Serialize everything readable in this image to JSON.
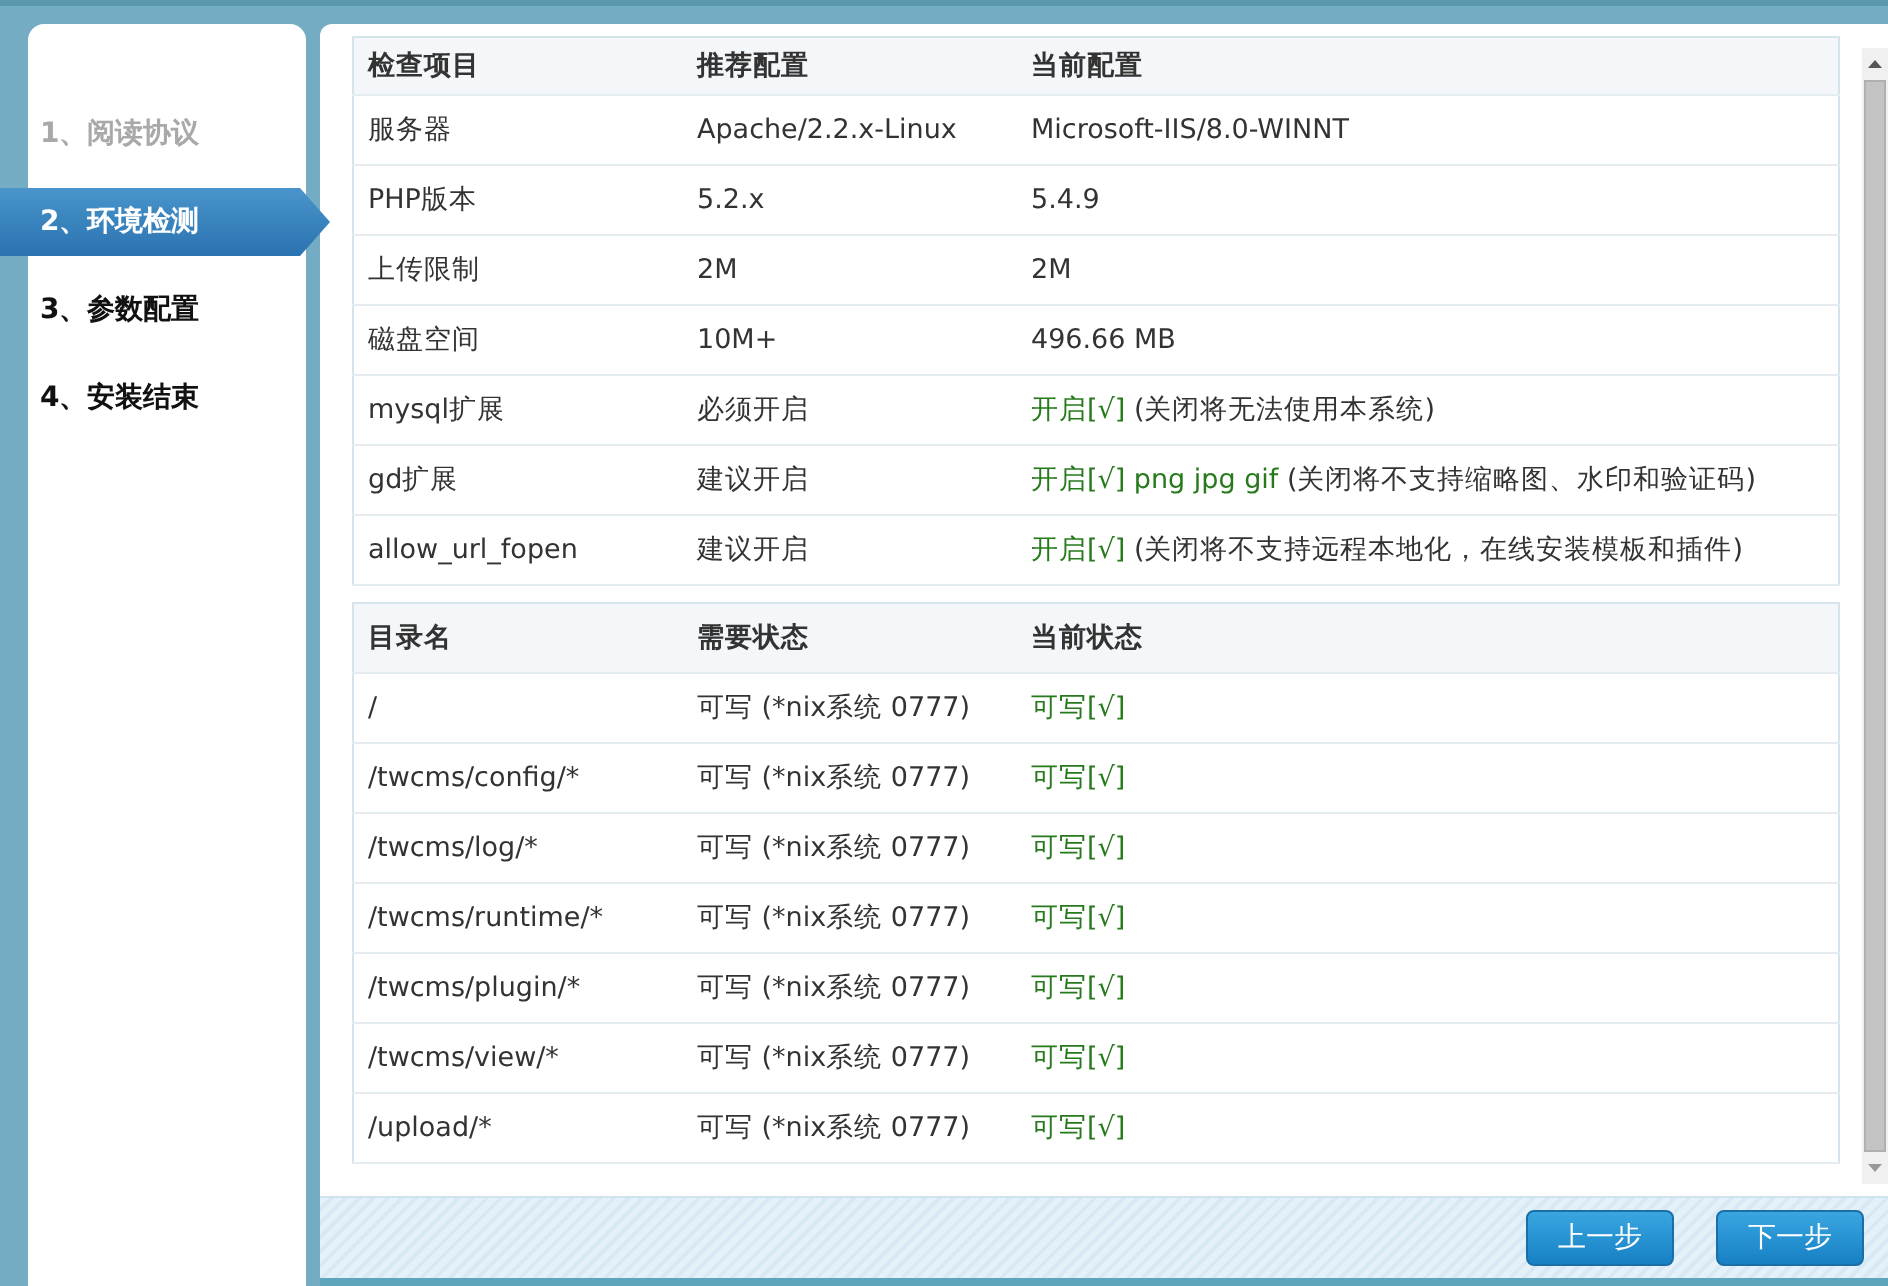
{
  "steps": [
    {
      "label": "1、阅读协议",
      "selected": false,
      "completed": true
    },
    {
      "label": "2、环境检测",
      "selected": true,
      "completed": false
    },
    {
      "label": "3、参数配置",
      "selected": false,
      "completed": false
    },
    {
      "label": "4、安装结束",
      "selected": false,
      "completed": false
    }
  ],
  "env_table": {
    "columns": [
      "检查项目",
      "推荐配置",
      "当前配置"
    ],
    "rows": [
      {
        "item": "服务器",
        "recommended": "Apache/2.2.x-Linux",
        "current": "Microsoft-IIS/8.0-WINNT"
      },
      {
        "item": "PHP版本",
        "recommended": "5.2.x",
        "current": "5.4.9"
      },
      {
        "item": "上传限制",
        "recommended": "2M",
        "current": "2M"
      },
      {
        "item": "磁盘空间",
        "recommended": "10M+",
        "current": "496.66 MB"
      },
      {
        "item": "mysql扩展",
        "recommended": "必须开启",
        "current": "开启[√]",
        "ok": true,
        "note": "(关闭将无法使用本系统)"
      },
      {
        "item": "gd扩展",
        "recommended": "建议开启",
        "current": "开启[√] png jpg gif",
        "ok": true,
        "note": "(关闭将不支持缩略图、水印和验证码)"
      },
      {
        "item": "allow_url_fopen",
        "recommended": "建议开启",
        "current": "开启[√]",
        "ok": true,
        "note": "(关闭将不支持远程本地化，在线安装模板和插件)"
      }
    ]
  },
  "dir_table": {
    "columns": [
      "目录名",
      "需要状态",
      "当前状态"
    ],
    "rows": [
      {
        "dir": "/",
        "required": "可写 (*nix系统 0777)",
        "current": "可写[√]",
        "ok": true
      },
      {
        "dir": "/twcms/config/*",
        "required": "可写 (*nix系统 0777)",
        "current": "可写[√]",
        "ok": true
      },
      {
        "dir": "/twcms/log/*",
        "required": "可写 (*nix系统 0777)",
        "current": "可写[√]",
        "ok": true
      },
      {
        "dir": "/twcms/runtime/*",
        "required": "可写 (*nix系统 0777)",
        "current": "可写[√]",
        "ok": true
      },
      {
        "dir": "/twcms/plugin/*",
        "required": "可写 (*nix系统 0777)",
        "current": "可写[√]",
        "ok": true
      },
      {
        "dir": "/twcms/view/*",
        "required": "可写 (*nix系统 0777)",
        "current": "可写[√]",
        "ok": true
      },
      {
        "dir": "/upload/*",
        "required": "可写 (*nix系统 0777)",
        "current": "可写[√]",
        "ok": true
      }
    ]
  },
  "buttons": [
    "上一步",
    "下一步"
  ]
}
